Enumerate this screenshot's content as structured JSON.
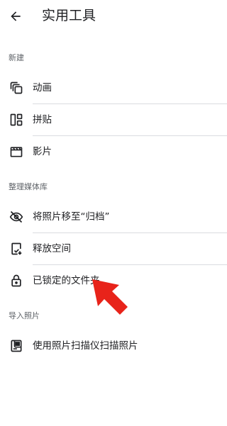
{
  "header": {
    "title": "实用工具",
    "back_icon": "arrow-back-icon"
  },
  "sections": [
    {
      "label": "新建",
      "items": [
        {
          "label": "动画",
          "icon": "animation-icon"
        },
        {
          "label": "拼贴",
          "icon": "collage-icon"
        },
        {
          "label": "影片",
          "icon": "movie-icon"
        }
      ]
    },
    {
      "label": "整理媒体库",
      "items": [
        {
          "label": "将照片移至“归档”",
          "icon": "archive-visibility-off-icon"
        },
        {
          "label": "释放空间",
          "icon": "free-up-space-icon"
        },
        {
          "label": "已锁定的文件夹",
          "icon": "lock-icon"
        }
      ]
    },
    {
      "label": "导入照片",
      "items": [
        {
          "label": "使用照片扫描仪扫描照片",
          "icon": "photoscan-icon"
        }
      ]
    }
  ],
  "colors": {
    "text_primary": "#202124",
    "text_secondary": "#5f6368",
    "divider": "#dadce0",
    "annotation_arrow": "#e8231a"
  }
}
